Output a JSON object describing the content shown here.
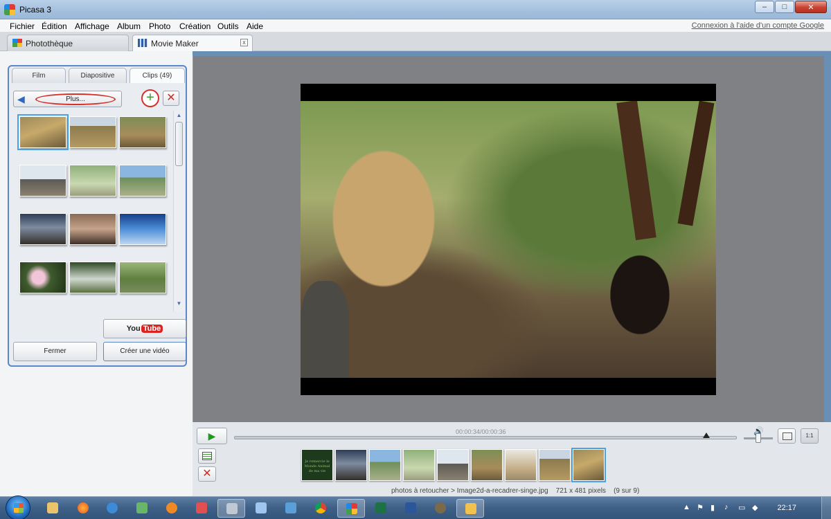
{
  "window": {
    "title": "Picasa 3",
    "controls": {
      "minimize": "–",
      "maximize": "□",
      "close": "✕"
    }
  },
  "menubar": {
    "items": [
      "Fichier",
      "Édition",
      "Affichage",
      "Album",
      "Photo",
      "Création",
      "Outils",
      "Aide"
    ],
    "signin_link": "Connexion à l'aide d'un compte Google"
  },
  "tabs": [
    {
      "label": "Photothèque",
      "icon": "library-icon"
    },
    {
      "label": "Movie Maker",
      "icon": "film-icon",
      "close": "x"
    }
  ],
  "left_panel": {
    "subtabs": [
      "Film",
      "Diapositive",
      "Clips (49)"
    ],
    "active_subtab": "Clips (49)",
    "plus_button": "Plus...",
    "add_glyph": "+",
    "remove_glyph": "✕",
    "youtube": {
      "you": "You",
      "tube": "Tube"
    },
    "close_button": "Fermer",
    "create_video_button": "Créer une vidéo"
  },
  "player": {
    "timecode": "00:00:34/00:00:36",
    "position_fraction": 0.94,
    "volume_fraction": 0.5,
    "one_to_one": "1:1"
  },
  "filmstrip": {
    "title_card_text": "Je remercie le Monde Animal de ma vie",
    "selected_index": 8,
    "count": 9
  },
  "status": {
    "path": "photos à retoucher > Image2d-a-recadrer-singe.jpg",
    "dimensions": "721 x 481 pixels",
    "position": "(9 sur 9)"
  },
  "taskbar": {
    "clock": "22:17"
  }
}
